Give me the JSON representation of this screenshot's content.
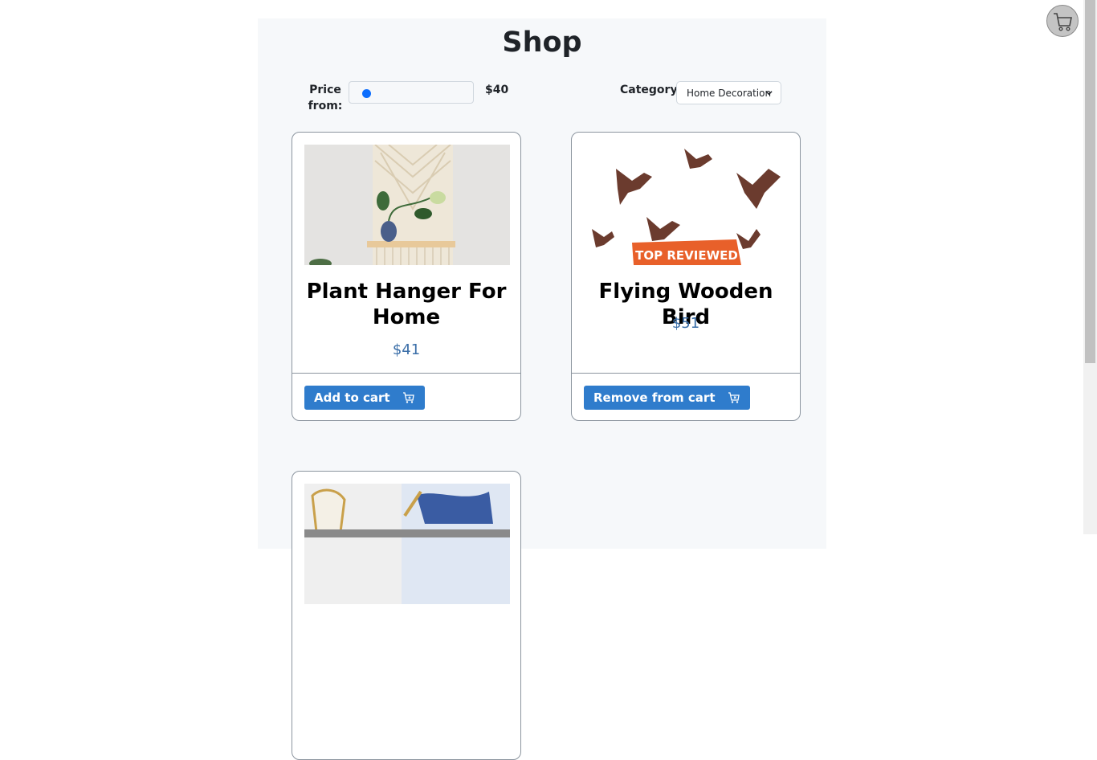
{
  "page": {
    "title": "Shop"
  },
  "filters": {
    "price_label": "Price from:",
    "price_value": "$40",
    "category_label": "Category",
    "category_selected": "Home Decoration"
  },
  "products": [
    {
      "name": "Plant Hanger For Home",
      "price": "$41",
      "button": "Add to cart"
    },
    {
      "name": "Flying Wooden Bird",
      "price": "$51",
      "button": "Remove from cart",
      "badge": "TOP REVIEWED"
    },
    {
      "name": "",
      "price": "",
      "button": ""
    }
  ],
  "colors": {
    "accent": "#2f7ccc",
    "price": "#3a6ea8",
    "panel": "#f6f8fa"
  },
  "icons": {
    "cart": "cart-icon",
    "add_cart": "cart-plus-icon",
    "remove_cart": "cart-x-icon",
    "chevron": "chevron-down-icon"
  }
}
